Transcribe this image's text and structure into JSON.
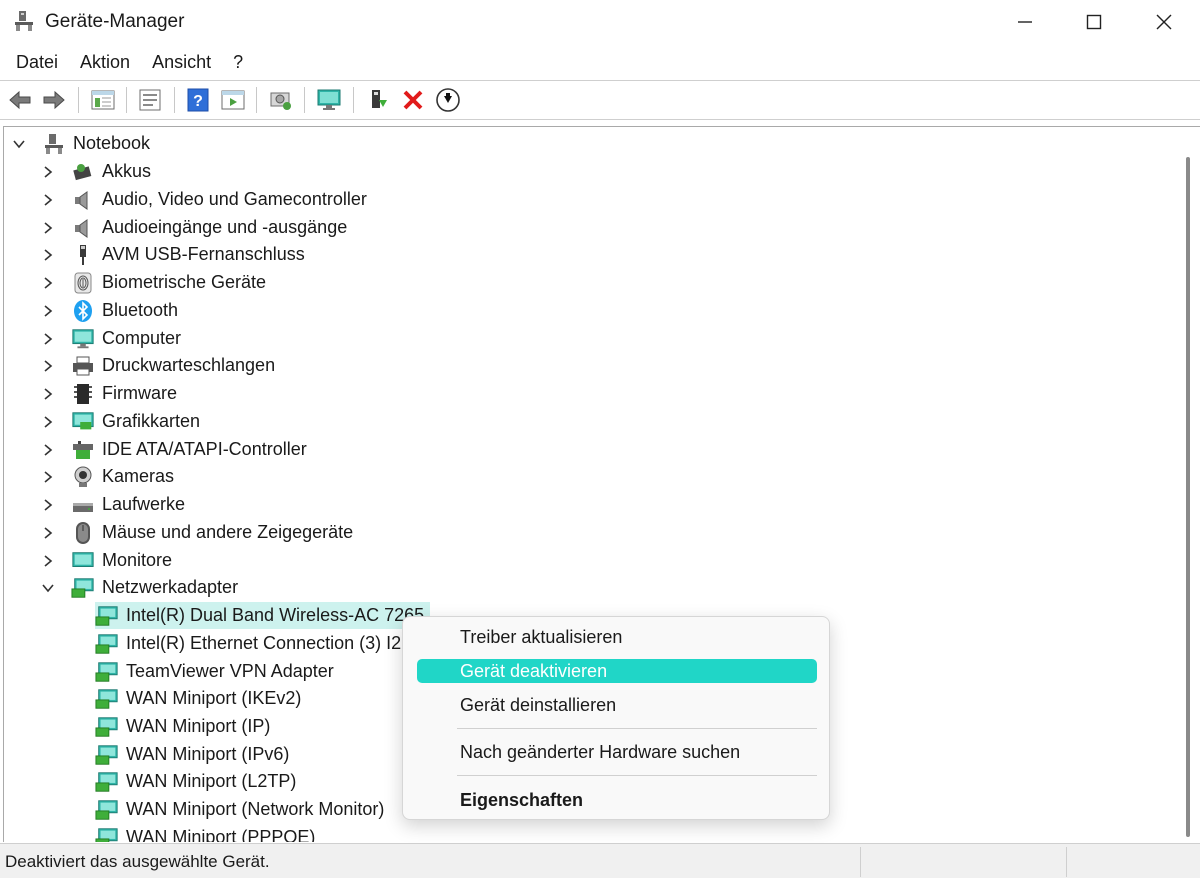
{
  "window": {
    "title": "Geräte-Manager"
  },
  "menubar": [
    "Datei",
    "Aktion",
    "Ansicht",
    "?"
  ],
  "toolbar": [
    "back-icon",
    "forward-icon",
    "show-hide-tree-icon",
    "properties-icon",
    "help-icon",
    "action-view-icon",
    "scan-hardware-icon",
    "monitor-icon",
    "update-driver-icon",
    "uninstall-icon",
    "disable-icon"
  ],
  "tree": {
    "root": "Notebook",
    "categories": [
      "Akkus",
      "Audio, Video und Gamecontroller",
      "Audioeingänge und -ausgänge",
      "AVM USB-Fernanschluss",
      "Biometrische Geräte",
      "Bluetooth",
      "Computer",
      "Druckwarteschlangen",
      "Firmware",
      "Grafikkarten",
      "IDE ATA/ATAPI-Controller",
      "Kameras",
      "Laufwerke",
      "Mäuse und andere Zeigegeräte",
      "Monitore",
      "Netzwerkadapter"
    ],
    "network_adapters": [
      "Intel(R) Dual Band Wireless-AC 7265",
      "Intel(R) Ethernet Connection (3) I2",
      "TeamViewer VPN Adapter",
      "WAN Miniport (IKEv2)",
      "WAN Miniport (IP)",
      "WAN Miniport (IPv6)",
      "WAN Miniport (L2TP)",
      "WAN Miniport (Network Monitor)",
      "WAN Miniport (PPPOE)"
    ]
  },
  "context_menu": {
    "update_driver": "Treiber aktualisieren",
    "disable_device": "Gerät deaktivieren",
    "uninstall_device": "Gerät deinstallieren",
    "scan_hardware": "Nach geänderter Hardware suchen",
    "properties": "Eigenschaften"
  },
  "statusbar": {
    "text": "Deaktiviert das ausgewählte Gerät."
  },
  "colors": {
    "highlight": "#20d6c7",
    "selection": "#cdf2ee"
  }
}
